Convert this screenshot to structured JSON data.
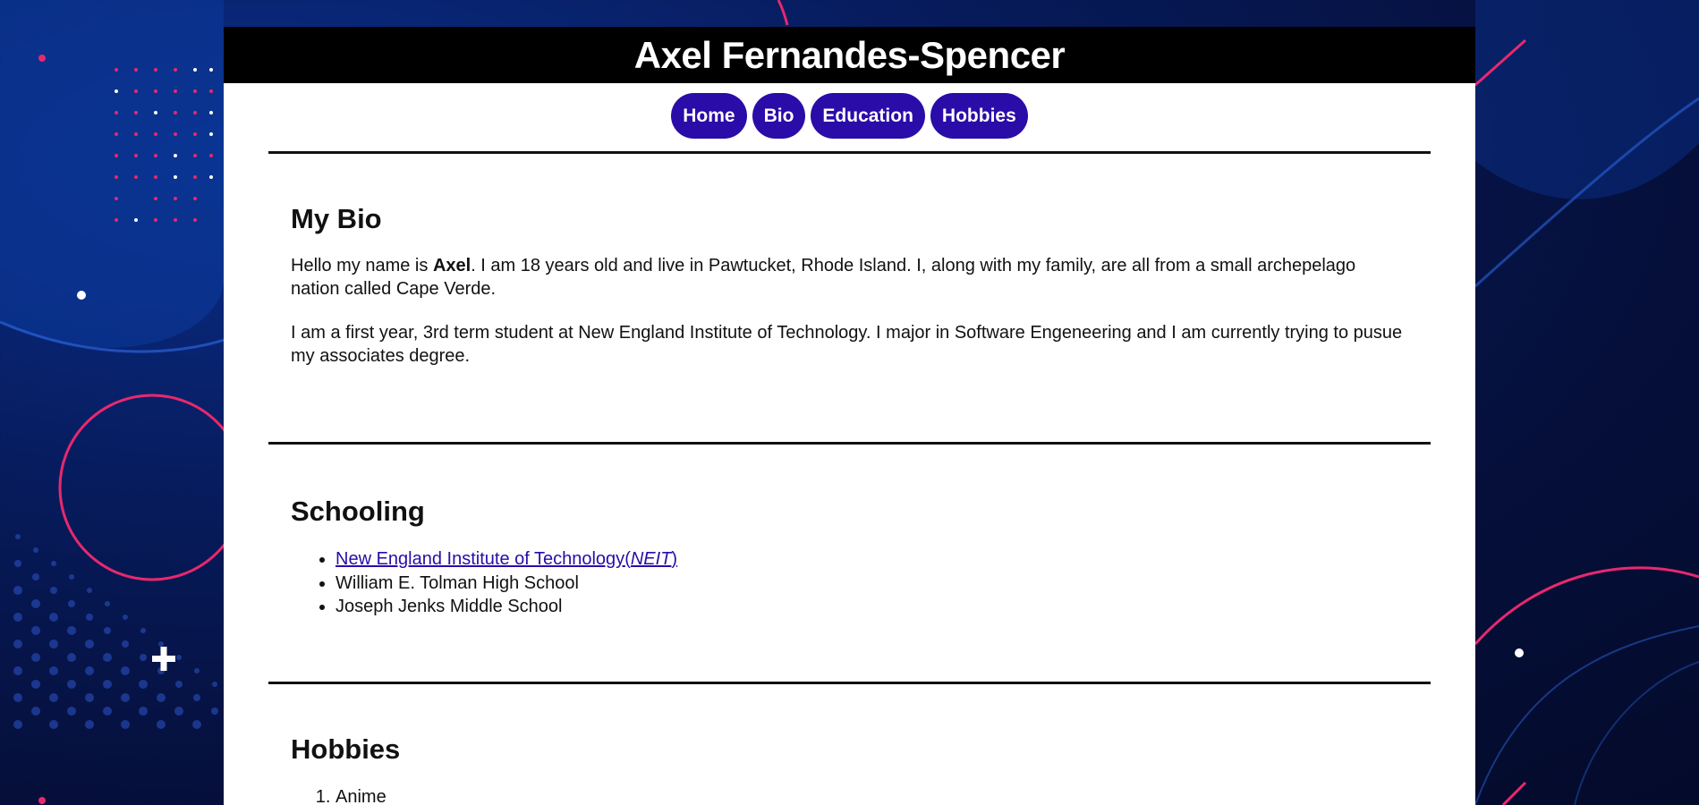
{
  "header": {
    "title": "Axel Fernandes-Spencer"
  },
  "nav": {
    "items": [
      {
        "label": "Home"
      },
      {
        "label": "Bio"
      },
      {
        "label": "Education"
      },
      {
        "label": "Hobbies"
      }
    ]
  },
  "bio": {
    "heading": "My Bio",
    "p1_before": "Hello my name is ",
    "p1_name": "Axel",
    "p1_after": ". I am 18 years old and live in Pawtucket, Rhode Island. I, along with my family, are all from a small archepelago nation called Cape Verde.",
    "p2": "I am a first year, 3rd term student at New England Institute of Technology. I major in Software Engeneering and I am currently trying to pusue my associates degree."
  },
  "schooling": {
    "heading": "Schooling",
    "link_text": "New England Institute of Technology",
    "link_abbr_open": "(",
    "link_abbr": "NEIT",
    "link_abbr_close": ")",
    "items": [
      "William E. Tolman High School",
      "Joseph Jenks Middle School"
    ]
  },
  "hobbies": {
    "heading": "Hobbies",
    "items": [
      "Anime"
    ]
  },
  "colors": {
    "nav_button": "#2a0ca8",
    "header_bg": "#000000",
    "link": "#2a0ca8",
    "accent_pink": "#e8286e",
    "background": "#071c5e"
  }
}
